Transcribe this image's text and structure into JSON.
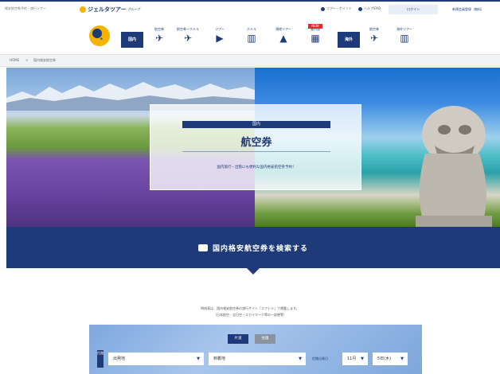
{
  "header": {
    "tagline": "格安航空券予約・旅行ツアー",
    "brand_name": "ジェルタツアー",
    "brand_group": "グループ",
    "util_links": [
      "ツアー・ポイント",
      "ヘルプ/FAQ"
    ],
    "login_label": "ログイン",
    "member_label": "新規会員登録（無料）"
  },
  "nav": {
    "logo_text": "e",
    "badge_domestic": "国内",
    "badge_overseas": "海外",
    "items_domestic": [
      {
        "label": "航空券",
        "icon": "plane-icon",
        "glyph": "✈"
      },
      {
        "label": "航空券＋ホテル",
        "icon": "plane-hotel-icon",
        "glyph": "✈"
      },
      {
        "label": "ツアー",
        "icon": "tour-icon",
        "glyph": "▶"
      },
      {
        "label": "ホテル",
        "icon": "hotel-icon",
        "glyph": "▥"
      },
      {
        "label": "現地ツアー",
        "icon": "activity-icon",
        "glyph": "▲"
      },
      {
        "label": "屋内旅",
        "icon": "building-icon",
        "glyph": "▦",
        "tag": "NEW"
      }
    ],
    "items_overseas": [
      {
        "label": "航空券",
        "icon": "plane-icon",
        "glyph": "✈"
      },
      {
        "label": "海外ツアー",
        "icon": "hotel-icon",
        "glyph": "▥"
      }
    ]
  },
  "breadcrumb": [
    "HOME",
    "国内格安航空券"
  ],
  "hero": {
    "pill": "国内",
    "title": "航空券",
    "subtitle": "国内旅行・出張にも便利な国内格安航空券予約！"
  },
  "search_band": {
    "label": "国内格安航空券を検索する"
  },
  "notice": {
    "line1": "時刻表は、国内格安航空券の旅行サイト「エアトリ」で掲載します。",
    "line2": "（日本航空・全日空・スカイマーク等の一部便等）"
  },
  "form": {
    "tab_oneway": "片道",
    "tab_roundtrip": "往復",
    "route_badge": "往路",
    "from_placeholder": "出発地",
    "to_placeholder": "到着地",
    "date_label": "往路出発日",
    "month": "11月",
    "day": "5日(木)"
  },
  "colors": {
    "brand_navy": "#1e3a78",
    "accent_yellow": "#f2b400",
    "new_tag_red": "#e02b2b"
  }
}
